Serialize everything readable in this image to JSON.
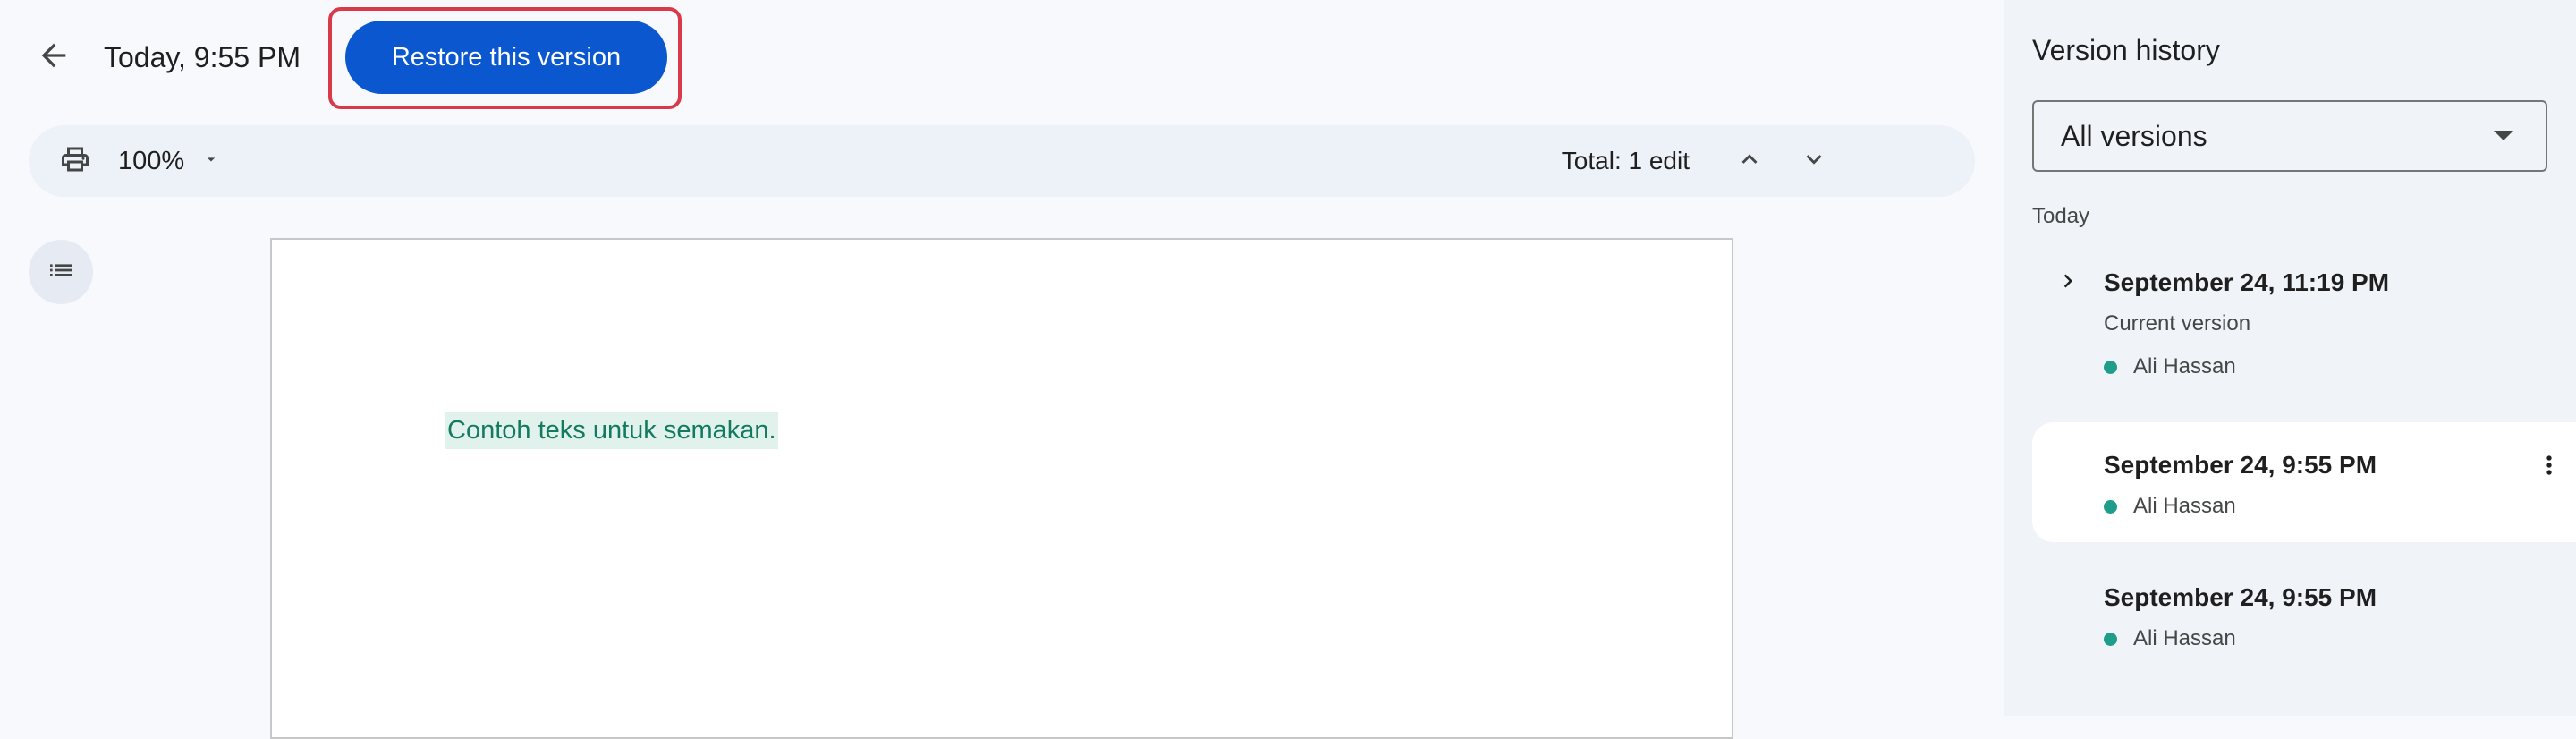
{
  "header": {
    "title": "Today, 9:55 PM",
    "restore_label": "Restore this version"
  },
  "toolbar": {
    "zoom": "100%",
    "edits_total": "Total: 1 edit"
  },
  "document": {
    "text": "Contoh teks untuk semakan."
  },
  "side_panel": {
    "title": "Version history",
    "filter_value": "All versions",
    "group_label": "Today",
    "versions": [
      {
        "date": "September 24, 11:19 PM",
        "subtitle": "Current version",
        "author": "Ali Hassan"
      },
      {
        "date": "September 24, 9:55 PM",
        "author": "Ali Hassan"
      },
      {
        "date": "September 24, 9:55 PM",
        "author": "Ali Hassan"
      }
    ]
  },
  "colors": {
    "accent": "#0b57d0",
    "highlight_border": "#d93a4a",
    "author_dot": "#1e9e8a",
    "inserted_text": "#137a5e",
    "inserted_bg": "#e1f2ec"
  },
  "icons": {
    "back": "arrow-back-icon",
    "print": "print-icon",
    "zoom_dropdown": "caret-down-icon",
    "prev_edit": "chevron-up-icon",
    "next_edit": "chevron-down-icon",
    "outline": "list-icon",
    "expand": "chevron-right-icon",
    "more": "more-vert-icon"
  }
}
